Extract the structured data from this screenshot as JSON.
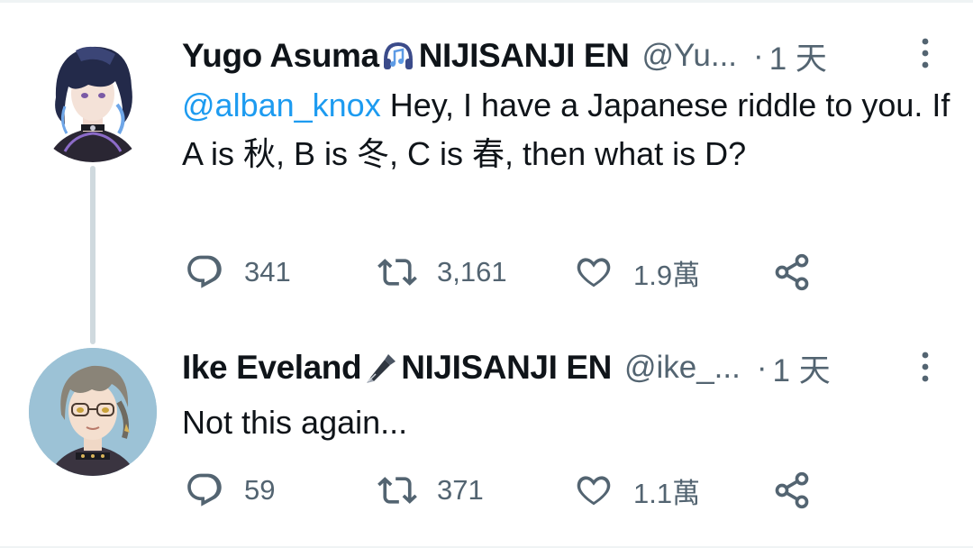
{
  "tweets": [
    {
      "author_name": "Yugo Asuma",
      "name_suffix": "NIJISANJI EN",
      "emoji": "headphone-music-emoji",
      "handle": "@Yu...",
      "dot": "·",
      "time": "1 天",
      "mention": "@alban_knox",
      "text": " Hey, I have a Japanese riddle to you. If A is 秋, B is 冬, C is 春, then what is D?",
      "replies": "341",
      "retweets": "3,161",
      "likes": "1.9萬"
    },
    {
      "author_name": "Ike Eveland",
      "name_suffix": "NIJISANJI EN",
      "emoji": "fountain-pen-emoji",
      "handle": "@ike_...",
      "dot": "·",
      "time": "1 天",
      "text": "Not this again...",
      "replies": "59",
      "retweets": "371",
      "likes": "1.1萬"
    }
  ],
  "colors": {
    "text": "#0f1419",
    "secondary": "#536471",
    "link": "#1d9bf0",
    "thread_line": "#cfd9de"
  }
}
